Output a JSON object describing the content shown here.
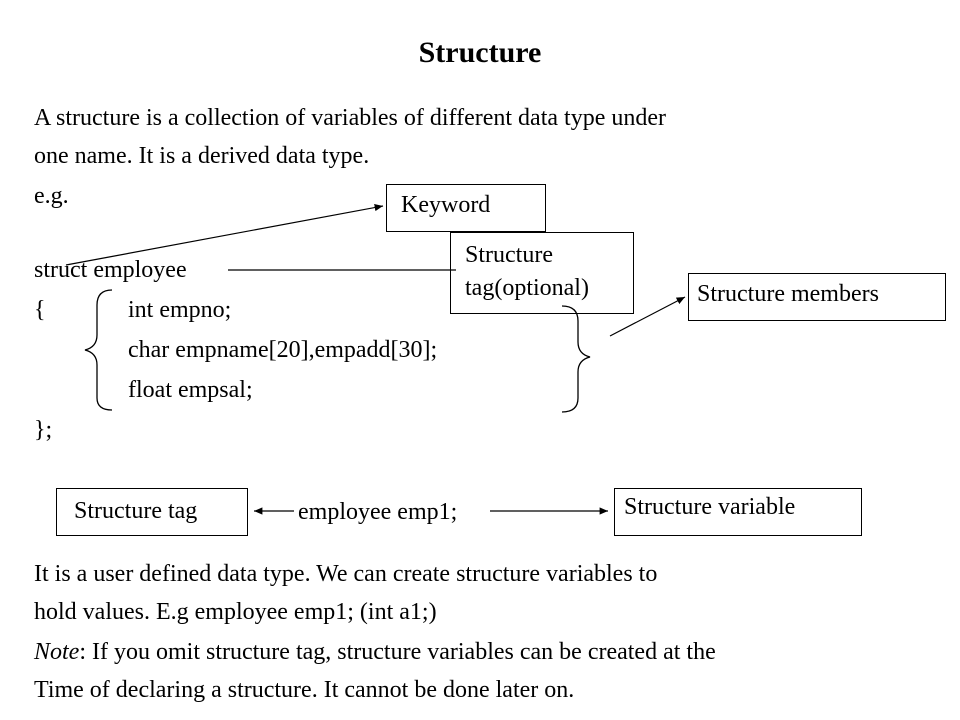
{
  "title": "Structure",
  "intro": {
    "line1": "A structure is a collection of variables of different data type under",
    "line2": "one  name. It is a derived data type.",
    "eg": "e.g."
  },
  "code": {
    "line1": "struct  employee",
    "open_brace": "{",
    "members": [
      "int empno;",
      "char empname[20],empadd[30];",
      "float empsal;"
    ],
    "close": "};"
  },
  "callouts": {
    "keyword": "Keyword",
    "tag_line1": "Structure",
    "tag_line2": "tag(optional)",
    "members": "Structure members",
    "struct_tag": "Structure tag",
    "struct_variable": "Structure variable"
  },
  "declaration": "employee emp1;",
  "para2": {
    "line1": "It is a user defined data type. We can create structure variables to",
    "line2": "hold values. E.g  employee emp1;  (int a1;)"
  },
  "note": {
    "label": "Note",
    "line1_rest": ": If you omit structure tag, structure variables can be created at the",
    "line2": "Time of declaring a structure. It cannot be done later on."
  }
}
